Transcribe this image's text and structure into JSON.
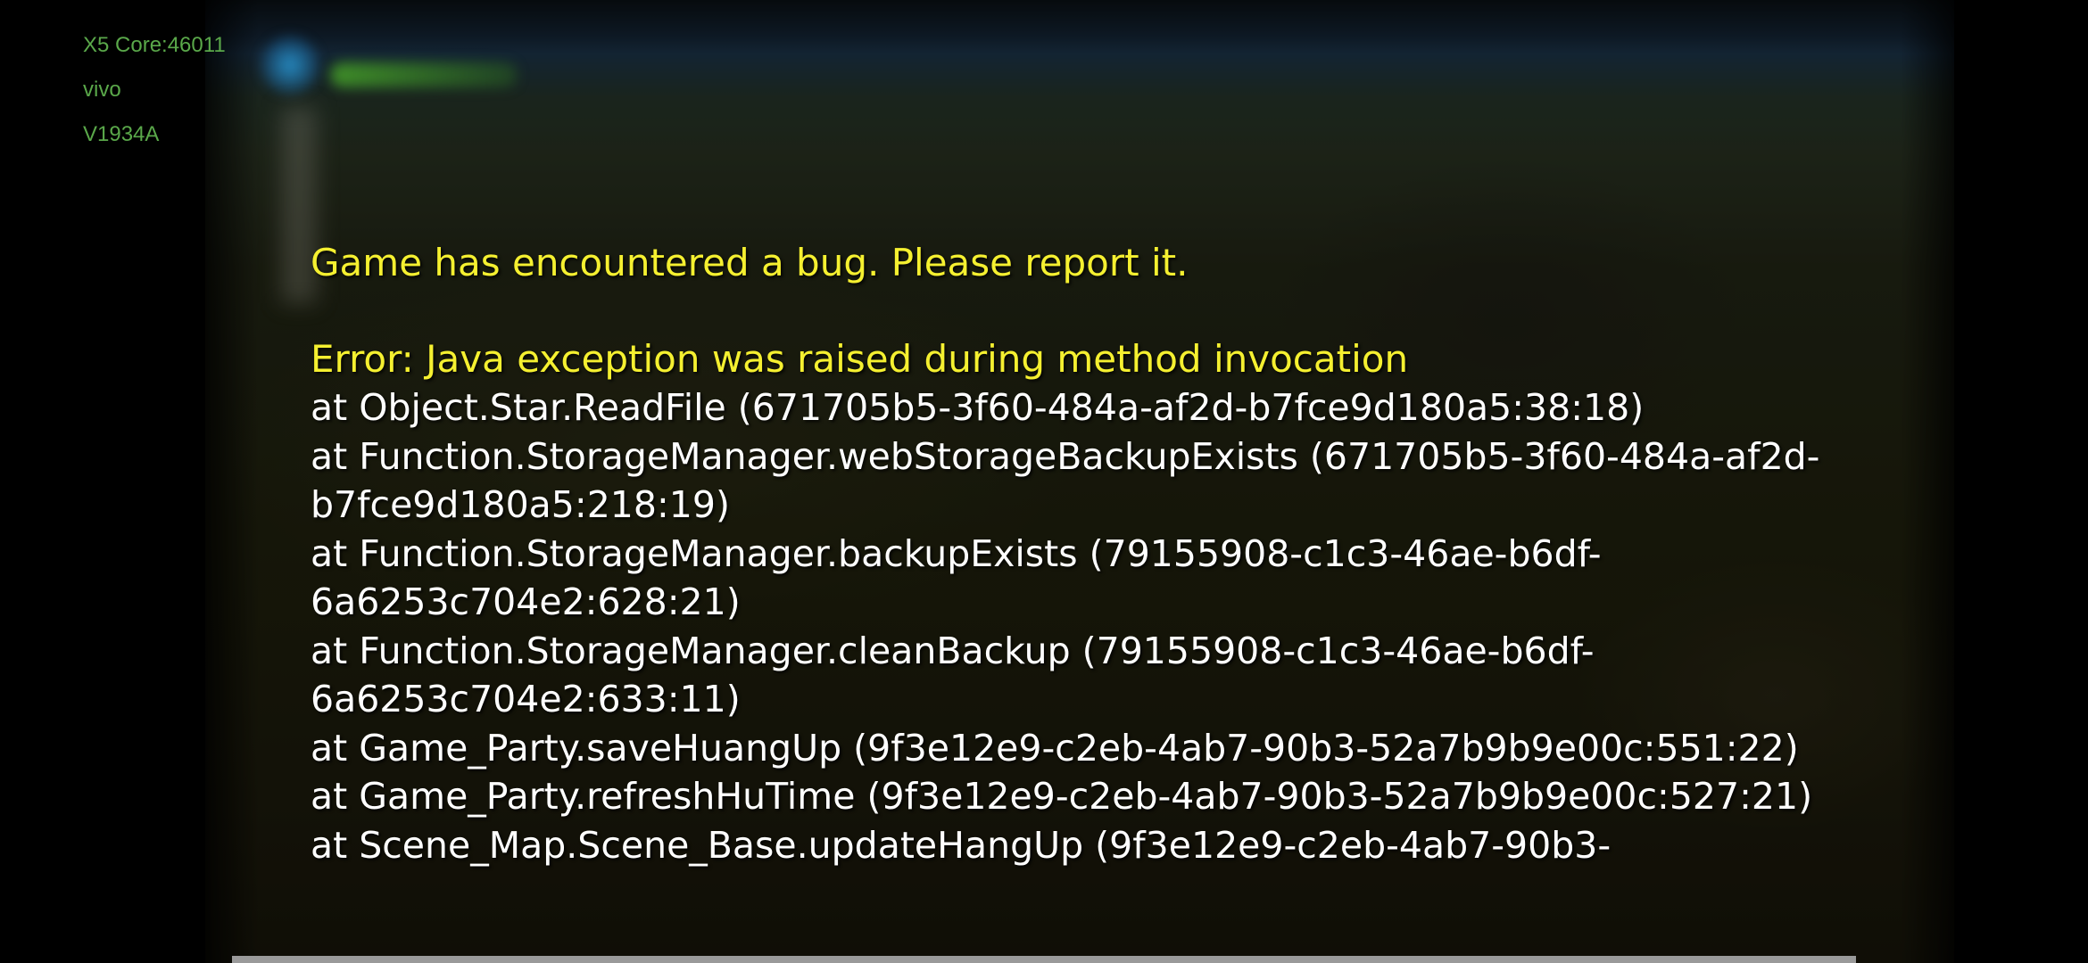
{
  "device_info": {
    "core": "X5 Core:46011",
    "brand": "vivo",
    "model": "V1934A"
  },
  "error": {
    "title": "Game has encountered a bug. Please report it.",
    "message": "Error: Java exception was raised during method invocation",
    "stack": [
      "at Object.Star.ReadFile (671705b5-3f60-484a-af2d-b7fce9d180a5:38:18)",
      "at Function.StorageManager.webStorageBackupExists (671705b5-3f60-484a-af2d-b7fce9d180a5:218:19)",
      "at Function.StorageManager.backupExists (79155908-c1c3-46ae-b6df-6a6253c704e2:628:21)",
      "at Function.StorageManager.cleanBackup (79155908-c1c3-46ae-b6df-6a6253c704e2:633:11)",
      "at Game_Party.saveHuangUp (9f3e12e9-c2eb-4ab7-90b3-52a7b9b9e00c:551:22)",
      "at Game_Party.refreshHuTime (9f3e12e9-c2eb-4ab7-90b3-52a7b9b9e00c:527:21)",
      "at Scene_Map.Scene_Base.updateHangUp (9f3e12e9-c2eb-4ab7-90b3-"
    ]
  }
}
